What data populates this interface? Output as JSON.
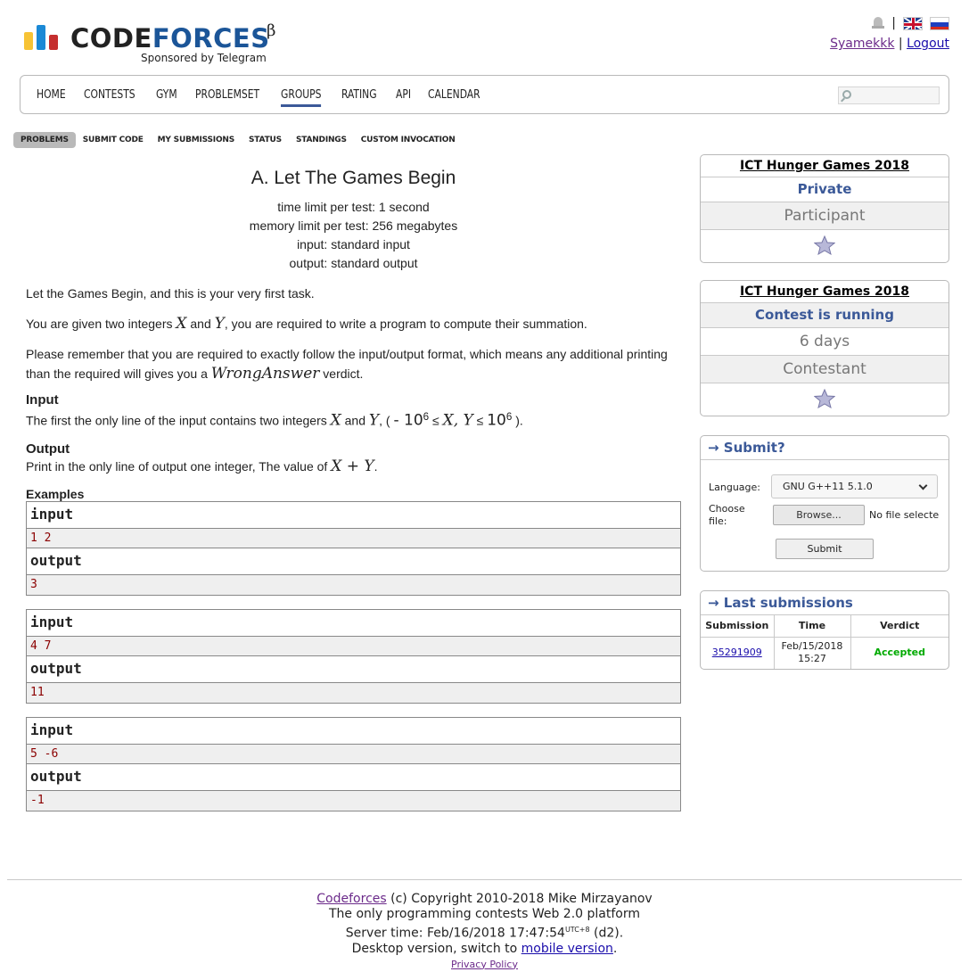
{
  "header": {
    "logo_text_code": "CODE",
    "logo_text_forces": "FORCES",
    "logo_beta": "β",
    "sponsor": "Sponsored by Telegram",
    "user": "Syamekkk",
    "user_sep": "|",
    "logout": "Logout",
    "lang_sep": "|",
    "colors": {
      "bar1": "#f7c335",
      "bar2": "#1b89d6",
      "bar3": "#c52f2f",
      "accent": "#3b5998"
    }
  },
  "menu": {
    "items": [
      "HOME",
      "CONTESTS",
      "GYM",
      "PROBLEMSET",
      "GROUPS",
      "RATING",
      "API",
      "CALENDAR"
    ],
    "active": "GROUPS"
  },
  "submenu": {
    "items": [
      "PROBLEMS",
      "SUBMIT CODE",
      "MY SUBMISSIONS",
      "STATUS",
      "STANDINGS",
      "CUSTOM INVOCATION"
    ],
    "active": "PROBLEMS"
  },
  "problem": {
    "title": "A. Let The Games Begin",
    "time_limit": "time limit per test: 1 second",
    "memory_limit": "memory limit per test: 256 megabytes",
    "input": "input: standard input",
    "output": "output: standard output",
    "p1": "Let the Games Begin, and this is your very first task.",
    "p2_a": "You are given two integers ",
    "p2_x": "X",
    "p2_and": " and ",
    "p2_y": "Y",
    "p2_b": ", you are required to write a program to compute their summation.",
    "p3_a": "Please remember that you are required to exactly follow the input/output format, which means any additional printing than the required will gives you a ",
    "p3_wa": "WrongAnswer",
    "p3_b": " verdict.",
    "input_title": "Input",
    "input_a": "The first the only line of the input contains two integers ",
    "input_x": "X",
    "input_and": " and ",
    "input_y": "Y",
    "input_b": ", ( ",
    "input_lo": "- 10",
    "input_exp1": "6",
    "input_le1": " ≤ ",
    "input_xy": "X, Y",
    "input_le2": " ≤ ",
    "input_hi": "10",
    "input_exp2": "6",
    "input_c": " ).",
    "output_title": "Output",
    "output_a": "Print in the only line of output one integer, The value of ",
    "output_expr": "X + Y",
    "output_b": ".",
    "examples_title": "Examples",
    "input_label": "input",
    "output_label": "output",
    "examples": [
      {
        "in": "1 2",
        "out": "3"
      },
      {
        "in": "4 7",
        "out": "11"
      },
      {
        "in": "5 -6",
        "out": "-1"
      }
    ]
  },
  "sidebar": {
    "box1": {
      "title": "ICT Hunger Games 2018",
      "status": "Private",
      "role": "Participant"
    },
    "box2": {
      "title": "ICT Hunger Games 2018",
      "status": "Contest is running",
      "time": "6 days",
      "role": "Contestant"
    },
    "submit": {
      "caption": "→ Submit?",
      "language_label": "Language:",
      "language_value": "GNU G++11 5.1.0",
      "file_label": "Choose file:",
      "browse": "Browse...",
      "no_file": "No file selecte",
      "submit": "Submit"
    },
    "last": {
      "caption": "→ Last submissions",
      "headers": [
        "Submission",
        "Time",
        "Verdict"
      ],
      "rows": [
        {
          "id": "35291909",
          "time": "Feb/15/2018 15:27",
          "verdict": "Accepted"
        }
      ]
    }
  },
  "footer": {
    "link": "Codeforces",
    "copyright": " (c) Copyright 2010-2018 Mike Mirzayanov",
    "line2": "The only programming contests Web 2.0 platform",
    "server_time": "Server time: Feb/16/2018 17:47:54",
    "tz": "UTC+8",
    "d2": " (d2).",
    "desktop": "Desktop version, switch to ",
    "mobile": "mobile version",
    "dot": ".",
    "privacy": "Privacy Policy"
  }
}
